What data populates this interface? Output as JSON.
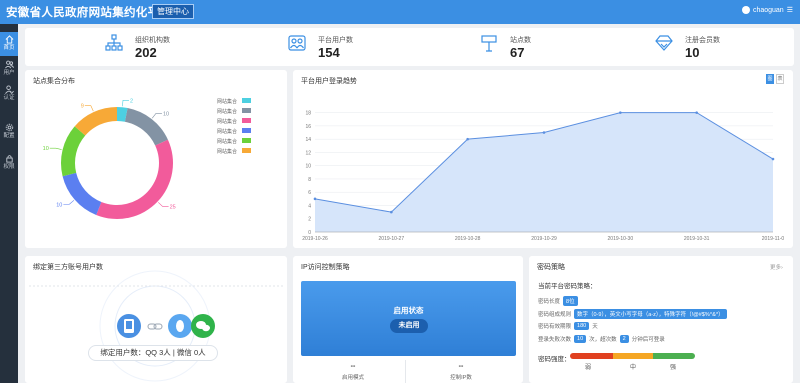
{
  "header": {
    "title": "安徽省人民政府网站集约化平台",
    "badge": "管理中心",
    "username": "chaoguan"
  },
  "sidebar": {
    "items": [
      {
        "label": "首页",
        "icon": "home-icon",
        "active": true
      },
      {
        "label": "用户",
        "icon": "users-icon",
        "active": false
      },
      {
        "label": "认证",
        "icon": "user-check-icon",
        "active": false
      },
      {
        "label": "配置",
        "icon": "gear-icon",
        "active": false
      },
      {
        "label": "权限",
        "icon": "lock-icon",
        "active": false
      }
    ]
  },
  "stats": [
    {
      "label": "组织机构数",
      "value": "202",
      "icon": "org-tree-icon"
    },
    {
      "label": "平台用户数",
      "value": "154",
      "icon": "group-users-icon"
    },
    {
      "label": "站点数",
      "value": "67",
      "icon": "signpost-icon"
    },
    {
      "label": "注册会员数",
      "value": "10",
      "icon": "diamond-icon"
    }
  ],
  "site_distribution": {
    "title": "站点集合分布",
    "legend": [
      {
        "label": "网站集合",
        "color": "#4dd0e1"
      },
      {
        "label": "网站集合",
        "color": "#8393a4"
      },
      {
        "label": "网站集合",
        "color": "#f25b9b"
      },
      {
        "label": "网站集合",
        "color": "#5b7ff0"
      },
      {
        "label": "网站集合",
        "color": "#6cd13a"
      },
      {
        "label": "网站集合",
        "color": "#f7a937"
      }
    ]
  },
  "login_trend": {
    "title": "平台用户登录趋势",
    "toggle_labels": [
      "图",
      "表"
    ]
  },
  "chart_data": [
    {
      "type": "pie",
      "title": "站点集合分布",
      "labels": [
        "网站集合",
        "网站集合",
        "网站集合",
        "网站集合",
        "网站集合",
        "网站集合"
      ],
      "values": [
        2,
        10,
        25,
        10,
        10,
        9
      ],
      "colors": [
        "#4dd0e1",
        "#8393a4",
        "#f25b9b",
        "#5b7ff0",
        "#6cd13a",
        "#f7a937"
      ],
      "hole": 0.75
    },
    {
      "type": "area",
      "title": "平台用户登录趋势",
      "x": [
        "2019-10-26",
        "2019-10-27",
        "2019-10-28",
        "2019-10-29",
        "2019-10-30",
        "2019-10-31",
        "2019-11-0"
      ],
      "y": [
        5,
        3,
        14,
        15,
        18,
        18,
        11
      ],
      "yticks": [
        0,
        2,
        4,
        6,
        8,
        10,
        12,
        14,
        16,
        18
      ],
      "ylim": [
        0,
        19
      ],
      "color": "#5b8fe0",
      "fill": "#d6e5fa"
    }
  ],
  "third_party": {
    "title": "绑定第三方账号用户数",
    "summary": "绑定用户数：QQ  3人 | 微信  0人"
  },
  "ip_policy": {
    "title": "IP访问控制策略",
    "status_label": "启用状态",
    "status_value": "未启用",
    "mode_value": "--",
    "mode_label": "启用模式",
    "count_value": "--",
    "count_label": "控制IP数"
  },
  "password_policy": {
    "title": "密码策略",
    "more": "更多›",
    "current": "当前平台密码策略：",
    "length_label": "密码长度",
    "length_value": "8位",
    "composition_label": "密码组成规则",
    "composition_value": "数字（0-9），英文小写字母（a-z），特殊字符（!@#$%^&*）",
    "validity_label": "密码有效期限",
    "validity_value": "180",
    "validity_unit": "天",
    "lock_label": "登录失败次数",
    "lock_value": "10",
    "lock_mid": "次，超次数",
    "lock_minutes": "2",
    "lock_tail": "分钟后可登录",
    "strength_label": "密码强度：",
    "strength_levels": [
      "弱",
      "中",
      "强"
    ],
    "strength_colors": [
      "#e0401f",
      "#f5a623",
      "#4caf50"
    ]
  }
}
